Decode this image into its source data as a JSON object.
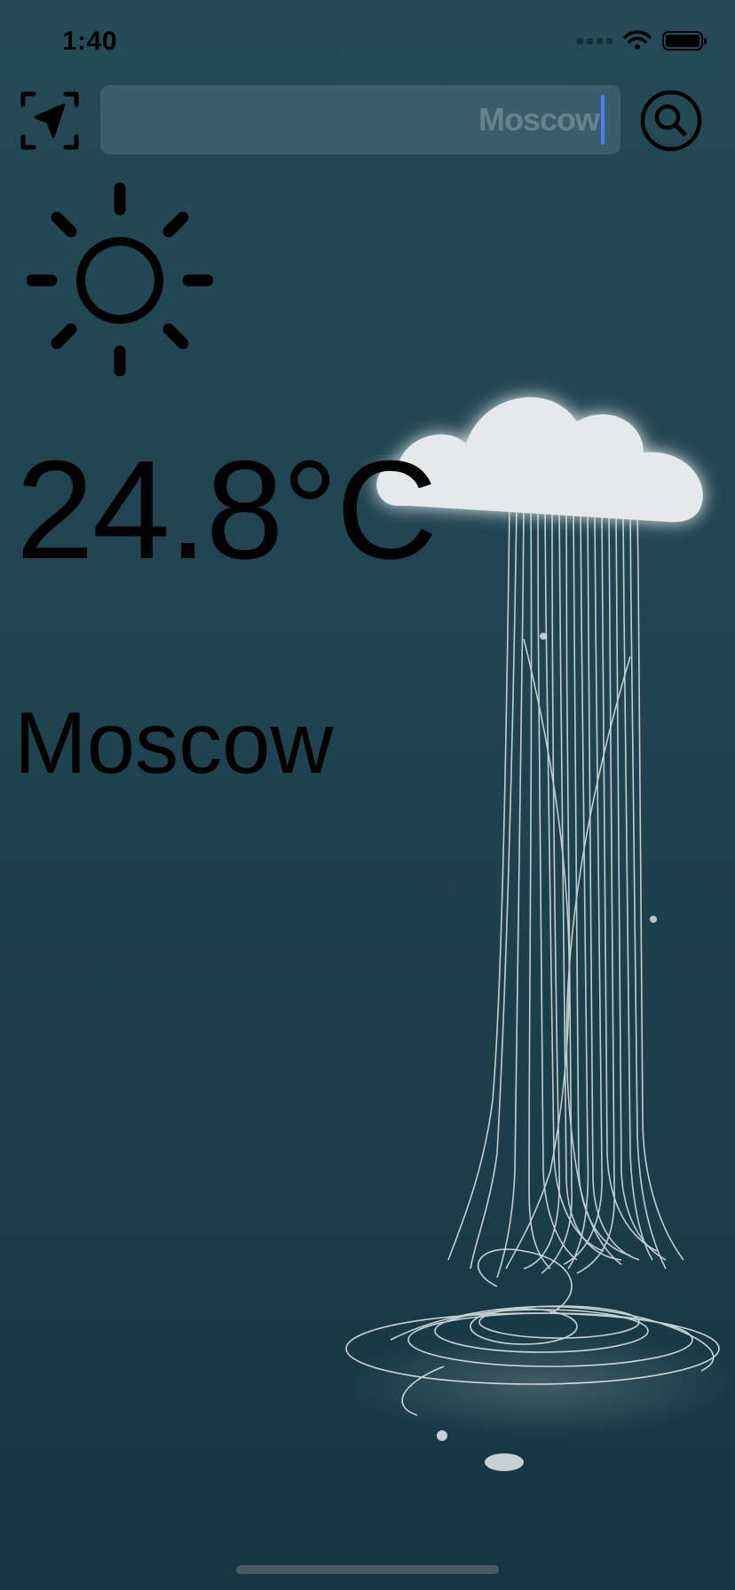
{
  "status_bar": {
    "time": "1:40"
  },
  "toolbar": {
    "location_icon": "location-arrow-icon",
    "search_value": "Moscow",
    "search_icon": "magnifying-glass-icon"
  },
  "weather": {
    "condition_icon": "sun-icon",
    "temperature": "24.8°C",
    "city": "Moscow"
  },
  "background": {
    "illustration": "rain-cloud-illustration",
    "colors": {
      "top": "#234a56",
      "bottom": "#173543",
      "caret": "#4f7cff"
    }
  }
}
